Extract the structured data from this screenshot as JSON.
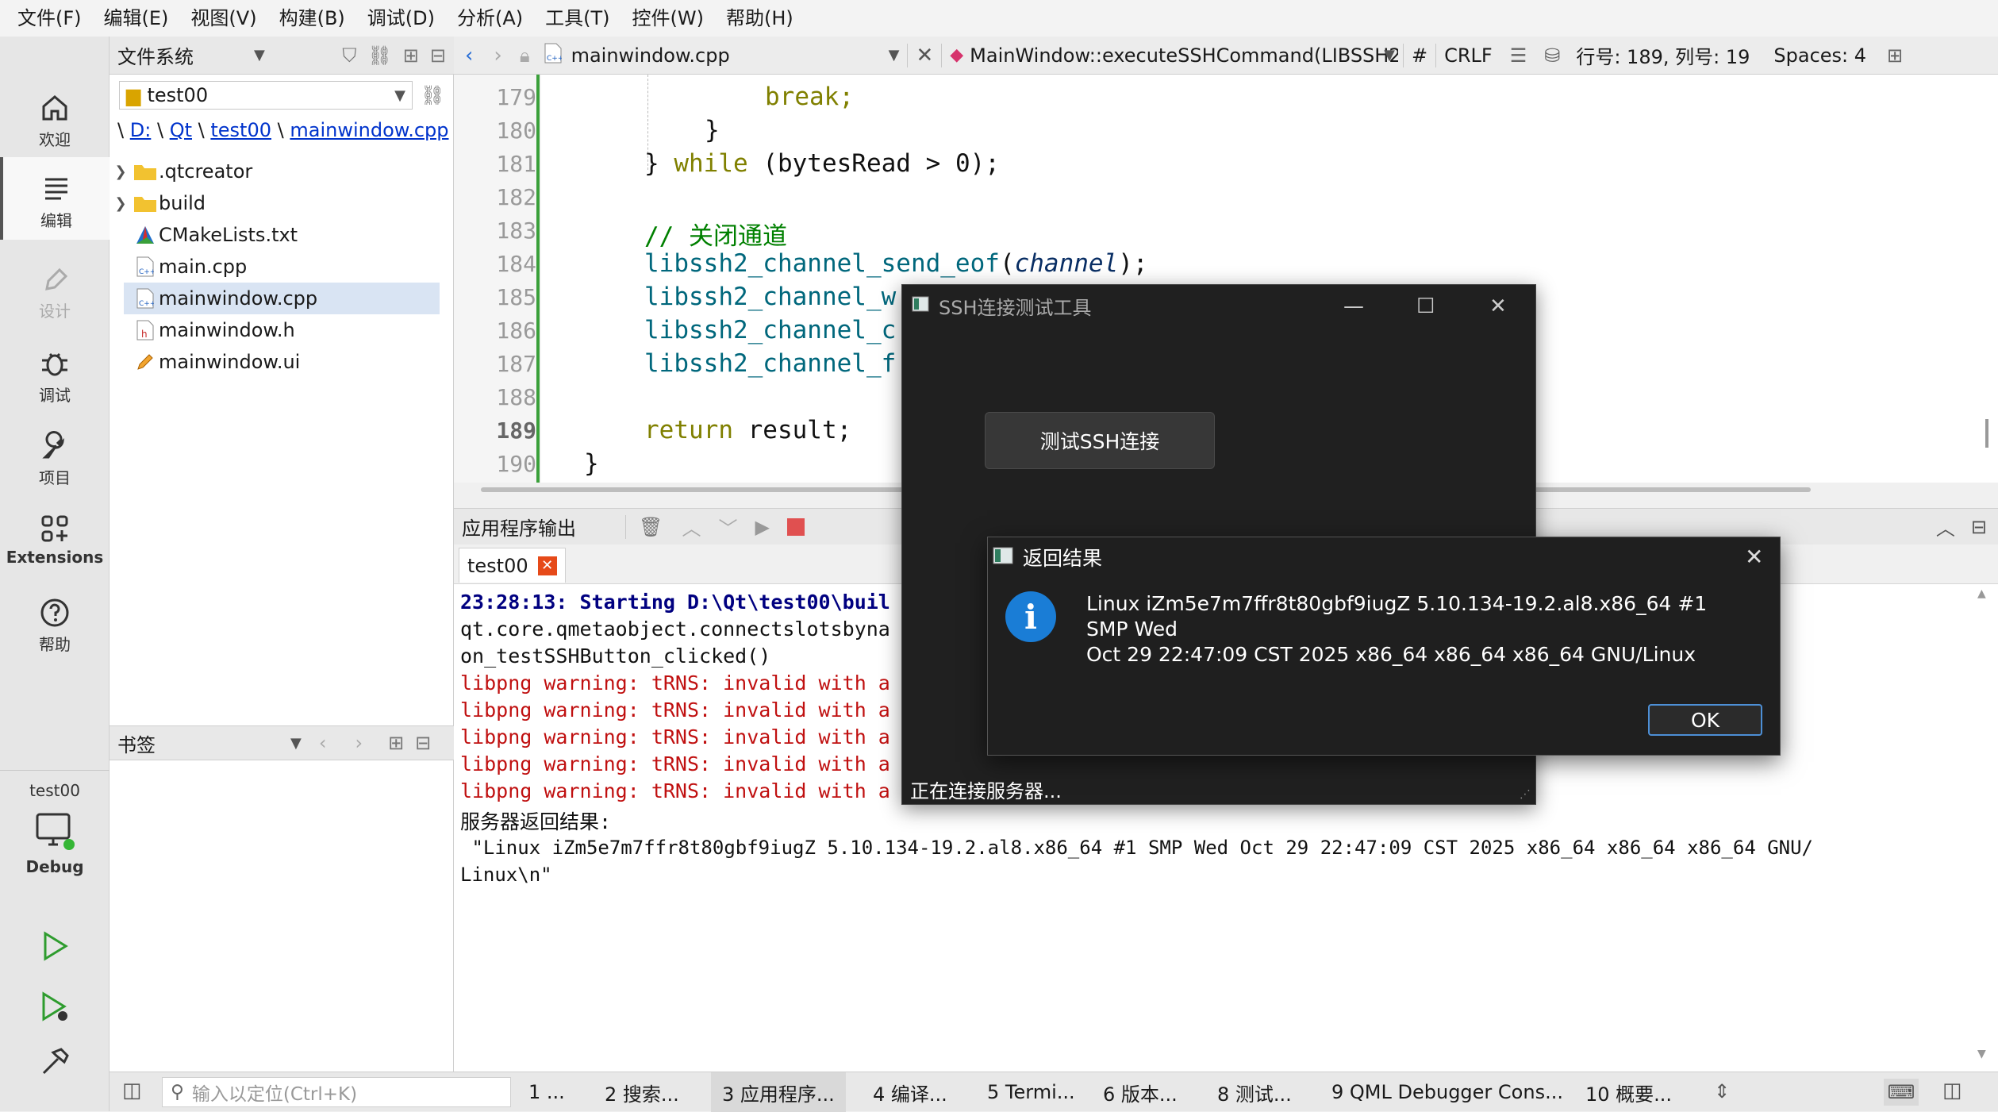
{
  "menu": [
    "文件(F)",
    "编辑(E)",
    "视图(V)",
    "构建(B)",
    "调试(D)",
    "分析(A)",
    "工具(T)",
    "控件(W)",
    "帮助(H)"
  ],
  "sidebar": {
    "welcome": "欢迎",
    "edit": "编辑",
    "design": "设计",
    "debug": "调试",
    "project": "项目",
    "extensions": "Extensions",
    "help": "帮助",
    "kit_project": "test00",
    "kit_mode": "Debug"
  },
  "filesystem": {
    "header": "文件系统",
    "combo": "test00",
    "crumb": [
      "D:",
      "Qt",
      "test00",
      "mainwindow.cpp"
    ],
    "crumb_root": "\\",
    "crumb_sep": "\\",
    "items": [
      {
        "label": ".qtcreator",
        "type": "folder"
      },
      {
        "label": "build",
        "type": "folder"
      },
      {
        "label": "CMakeLists.txt",
        "type": "cmake"
      },
      {
        "label": "main.cpp",
        "type": "cpp"
      },
      {
        "label": "mainwindow.cpp",
        "type": "cpp"
      },
      {
        "label": "mainwindow.h",
        "type": "h"
      },
      {
        "label": "mainwindow.ui",
        "type": "ui"
      }
    ]
  },
  "bookmarks": {
    "header": "书签"
  },
  "editor_toolbar": {
    "file": "mainwindow.cpp",
    "symbol": "MainWindow::executeSSHCommand(LIBSSH2...",
    "hash": "#",
    "line_ending": "CRLF",
    "position": "行号: 189, 列号: 19",
    "indent": "Spaces: 4"
  },
  "code": {
    "line_numbers": [
      "179",
      "180",
      "181",
      "182",
      "183",
      "184",
      "185",
      "186",
      "187",
      "188",
      "189",
      "190"
    ],
    "current_line": "189",
    "l179": "break;",
    "l180": "}",
    "l181_a": "} ",
    "l181_kw": "while",
    "l181_b": " (bytesRead > 0);",
    "l183": "// 关闭通道",
    "l184_fn": "libssh2_channel_send_eof",
    "l184_p1": "(",
    "l184_arg": "channel",
    "l184_p2": ");",
    "l185": "libssh2_channel_w",
    "l186": "libssh2_channel_c",
    "l187": "libssh2_channel_f",
    "l189_kw": "return",
    "l189_rest": " result;",
    "l190": "}"
  },
  "output": {
    "header": "应用程序输出",
    "tab": "test00",
    "lines": [
      "23:28:13: Starting D:\\Qt\\test00\\buil",
      "qt.core.qmetaobject.connectslotsbyna",
      "on_testSSHButton_clicked()",
      "libpng warning: tRNS: invalid with a",
      "libpng warning: tRNS: invalid with a",
      "libpng warning: tRNS: invalid with a",
      "libpng warning: tRNS: invalid with a",
      "libpng warning: tRNS: invalid with a",
      "服务器返回结果:",
      " \"Linux iZm5e7m7ffr8t80gbf9iugZ 5.10.134-19.2.al8.x86_64 #1 SMP Wed Oct 29 22:47:09 CST 2025 x86_64 x86_64 x86_64 GNU/",
      "Linux\\n\""
    ]
  },
  "statusbar": {
    "locator_placeholder": "输入以定位(Ctrl+K)",
    "tabs": [
      "1 ...",
      "2 搜索...",
      "3 应用程序...",
      "4 编译...",
      "5 Termi...",
      "6 版本...",
      "8 测试...",
      "9 QML Debugger Cons...",
      "10 概要..."
    ]
  },
  "ssh_window": {
    "title": "SSH连接测试工具",
    "button": "测试SSH连接",
    "status": "正在连接服务器..."
  },
  "message_box": {
    "title": "返回结果",
    "icon": "i",
    "text_line1": "Linux iZm5e7m7ffr8t80gbf9iugZ 5.10.134-19.2.al8.x86_64 #1 SMP Wed",
    "text_line2": "Oct 29 22:47:09 CST 2025 x86_64 x86_64 x86_64 GNU/Linux",
    "ok": "OK"
  },
  "colors": {
    "accent_blue": "#1a7dd6",
    "keyword": "#808000",
    "comment": "#008000",
    "warning_red": "#c01010",
    "current_line_marker": "#3aa03a"
  }
}
